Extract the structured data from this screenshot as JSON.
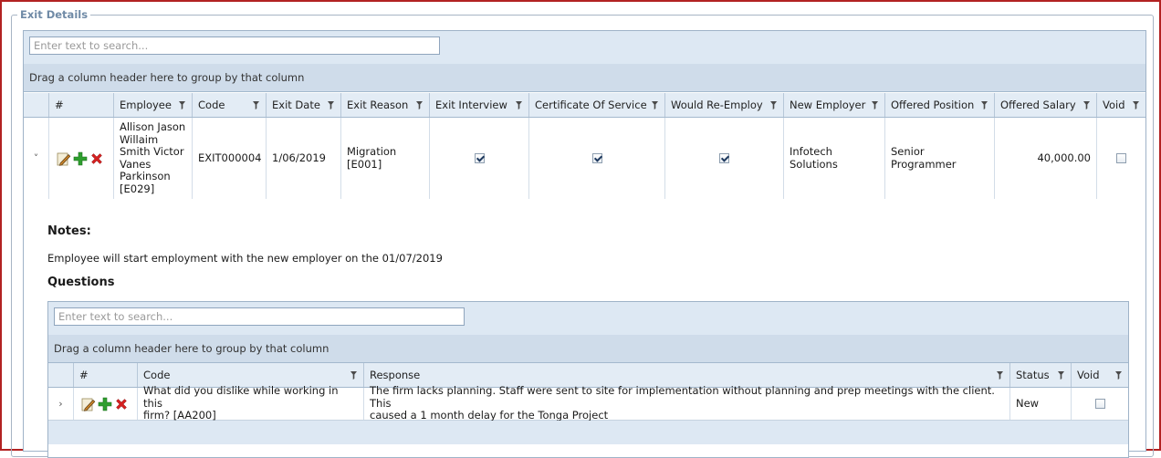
{
  "section": {
    "legend": "Exit Details"
  },
  "outer_grid": {
    "search_placeholder": "Enter text to search...",
    "group_hint": "Drag a column header here to group by that column",
    "columns": [
      "#",
      "Employee",
      "Code",
      "Exit Date",
      "Exit Reason",
      "Exit Interview",
      "Certificate Of Service",
      "Would Re-Employ",
      "New Employer",
      "Offered Position",
      "Offered Salary",
      "Void"
    ],
    "row": {
      "employee_lines": [
        "Allison Jason",
        "Willaim",
        "Smith Victor",
        "Vanes",
        "Parkinson",
        "[E029]"
      ],
      "code": "EXIT000004",
      "exit_date": "1/06/2019",
      "exit_reason_lines": [
        "Migration",
        "[E001]"
      ],
      "exit_interview": true,
      "certificate_of_service": true,
      "would_re_employ": true,
      "new_employer_lines": [
        "Infotech",
        "Solutions"
      ],
      "offered_position_lines": [
        "Senior",
        "Programmer"
      ],
      "offered_salary": "40,000.00",
      "void": false
    }
  },
  "detail": {
    "notes_title": "Notes:",
    "notes_text": "Employee will start employment with the new employer on the 01/07/2019",
    "questions_title": "Questions"
  },
  "inner_grid": {
    "search_placeholder": "Enter text to search...",
    "group_hint": "Drag a column header here to group by that column",
    "columns": [
      "#",
      "Code",
      "Response",
      "Status",
      "Void"
    ],
    "row": {
      "code_lines": [
        "What did you dislike while working in this",
        "firm? [AA200]"
      ],
      "response_lines": [
        "The firm lacks planning. Staff were sent to site for implementation without planning and prep meetings with the client. This",
        "caused a 1 month delay for the Tonga Project"
      ],
      "status": "New",
      "void": false
    }
  },
  "icons": {
    "edit": "pencil-edit-icon",
    "add": "green-plus-icon",
    "delete": "red-x-icon",
    "filter": "filter-funnel-icon",
    "expand": "chevron-icon"
  },
  "colors": {
    "border_accent": "#b22222",
    "header_bg": "#e3ecf5",
    "group_bg": "#cfdcea",
    "search_bg": "#dde8f3",
    "add_green": "#2e9e2e",
    "delete_red": "#d42020"
  }
}
